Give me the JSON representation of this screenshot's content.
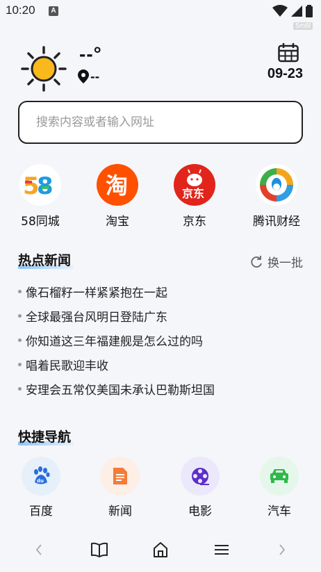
{
  "status_bar": {
    "time": "10:20",
    "notification_badge": "A",
    "tag": "5m6l"
  },
  "weather": {
    "temperature": "--°",
    "location": "--",
    "date": "09-23",
    "icon": "sun-icon"
  },
  "search": {
    "placeholder": "搜索内容或者输入网址"
  },
  "shortcuts": [
    {
      "label": "58同城",
      "icon": "58-logo"
    },
    {
      "label": "淘宝",
      "icon": "taobao-logo"
    },
    {
      "label": "京东",
      "icon": "jd-logo"
    },
    {
      "label": "腾讯财经",
      "icon": "tencent-finance-logo"
    }
  ],
  "hot_news": {
    "title": "热点新闻",
    "refresh_label": "换一批",
    "items": [
      "像石榴籽一样紧紧抱在一起",
      "全球最强台风明日登陆广东",
      "你知道这三年福建舰是怎么过的吗",
      "唱着民歌迎丰收",
      "安理会五常仅美国未承认巴勒斯坦国"
    ]
  },
  "quick_nav": {
    "title": "快捷导航",
    "items": [
      {
        "label": "百度",
        "icon": "baidu-paw-icon"
      },
      {
        "label": "新闻",
        "icon": "news-doc-icon"
      },
      {
        "label": "电影",
        "icon": "film-reel-icon"
      },
      {
        "label": "汽车",
        "icon": "car-icon"
      }
    ]
  },
  "colors": {
    "accent_blue": "#8ec5f8",
    "taobao": "#ff5000",
    "jd": "#e1251b"
  }
}
